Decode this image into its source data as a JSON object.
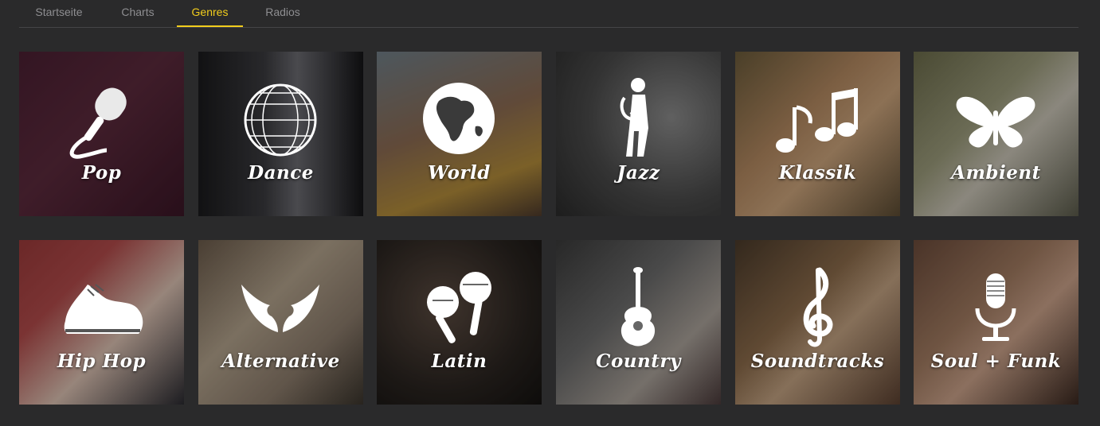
{
  "nav": {
    "tabs": [
      {
        "label": "Startseite",
        "active": false
      },
      {
        "label": "Charts",
        "active": false
      },
      {
        "label": "Genres",
        "active": true
      },
      {
        "label": "Radios",
        "active": false
      }
    ],
    "accent_color": "#f2cd1c"
  },
  "genres": [
    {
      "label": "Pop",
      "icon": "microphone-icon"
    },
    {
      "label": "Dance",
      "icon": "disco-ball-icon"
    },
    {
      "label": "World",
      "icon": "globe-icon"
    },
    {
      "label": "Jazz",
      "icon": "saxophone-player-icon"
    },
    {
      "label": "Klassik",
      "icon": "music-notes-icon"
    },
    {
      "label": "Ambient",
      "icon": "butterfly-icon"
    },
    {
      "label": "Hip Hop",
      "icon": "sneaker-icon"
    },
    {
      "label": "Alternative",
      "icon": "wings-icon"
    },
    {
      "label": "Latin",
      "icon": "maracas-icon"
    },
    {
      "label": "Country",
      "icon": "guitar-icon"
    },
    {
      "label": "Soundtracks",
      "icon": "treble-clef-icon"
    },
    {
      "label": "Soul + Funk",
      "icon": "retro-microphone-icon"
    }
  ]
}
